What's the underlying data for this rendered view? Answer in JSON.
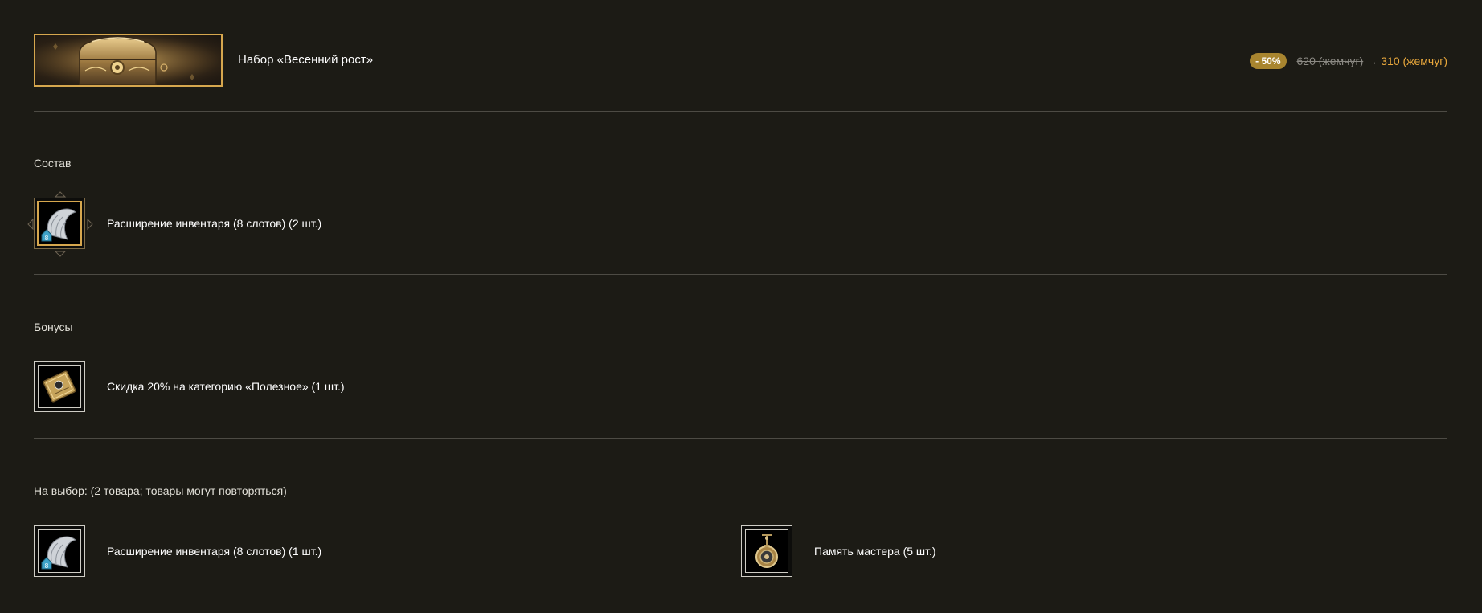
{
  "header": {
    "title": "Набор «Весенний рост»",
    "discount_badge": "- 50%",
    "old_price": "620 (жемчуг)",
    "arrow": "→",
    "new_price": "310 (жемчуг)",
    "banner_icon": "treasure-chest-image"
  },
  "composition": {
    "label": "Состав",
    "items": [
      {
        "label": "Расширение инвентаря (8 слотов) (2 шт.)",
        "icon": "inventory-bag-icon",
        "badge": "8"
      }
    ]
  },
  "bonuses": {
    "label": "Бонусы",
    "items": [
      {
        "label": "Скидка 20% на категорию «Полезное» (1 шт.)",
        "icon": "discount-coupon-icon"
      }
    ]
  },
  "choice": {
    "label": "На выбор: (2 товара; товары могут повторяться)",
    "items": [
      {
        "label": "Расширение инвентаря (8 слотов) (1 шт.)",
        "icon": "inventory-bag-icon",
        "badge": "8"
      },
      {
        "label": "Память мастера (5 шт.)",
        "icon": "pendant-icon"
      }
    ]
  },
  "colors": {
    "background": "#1c1b15",
    "accent_gold": "#d6a74e",
    "price_orange": "#e9a83c",
    "badge_bg": "#a8852f",
    "divider": "#4d4b44"
  }
}
